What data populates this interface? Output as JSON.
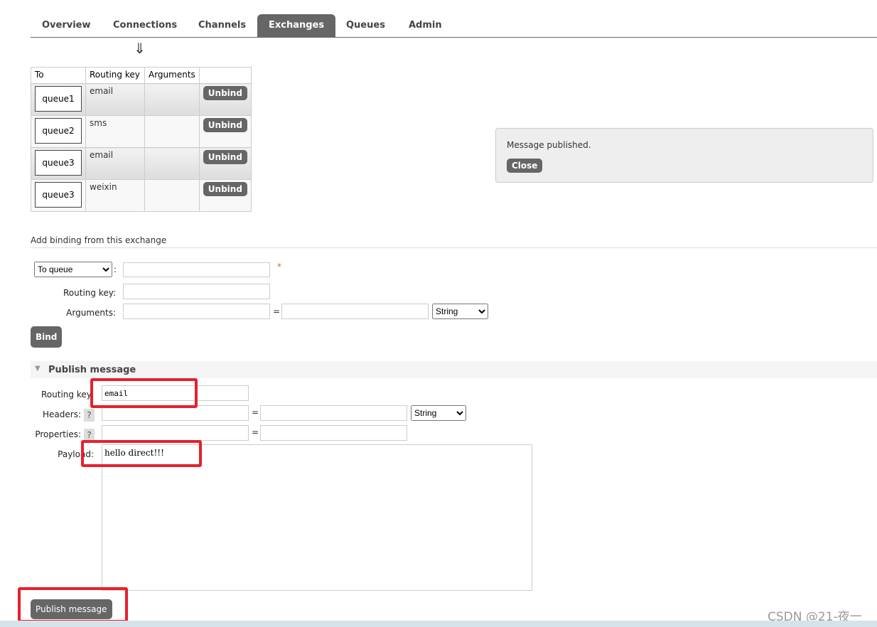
{
  "tabs": [
    "Overview",
    "Connections",
    "Channels",
    "Exchanges",
    "Queues",
    "Admin"
  ],
  "active_tab": "Exchanges",
  "arrow": "⇓",
  "bindings": {
    "headers": [
      "To",
      "Routing key",
      "Arguments",
      ""
    ],
    "rows": [
      {
        "to": "queue1",
        "key": "email",
        "args": "",
        "action": "Unbind"
      },
      {
        "to": "queue2",
        "key": "sms",
        "args": "",
        "action": "Unbind"
      },
      {
        "to": "queue3",
        "key": "email",
        "args": "",
        "action": "Unbind"
      },
      {
        "to": "queue3",
        "key": "weixin",
        "args": "",
        "action": "Unbind"
      }
    ]
  },
  "notice": {
    "text": "Message published.",
    "close": "Close"
  },
  "add_binding": {
    "title": "Add binding from this exchange",
    "dest_type": "To queue",
    "required": "*",
    "routing_key_label": "Routing key:",
    "arguments_label": "Arguments:",
    "eq": "=",
    "arg_type": "String",
    "bind": "Bind",
    "colon": ":"
  },
  "publish": {
    "title": "Publish message",
    "routing_key_label": "Routing key:",
    "routing_key": "email",
    "headers_label": "Headers:",
    "properties_label": "Properties:",
    "help": "?",
    "eq": "=",
    "header_type": "String",
    "payload_label": "Payload:",
    "payload": "hello direct!!!",
    "button": "Publish message"
  },
  "watermark": "CSDN @21-夜一"
}
